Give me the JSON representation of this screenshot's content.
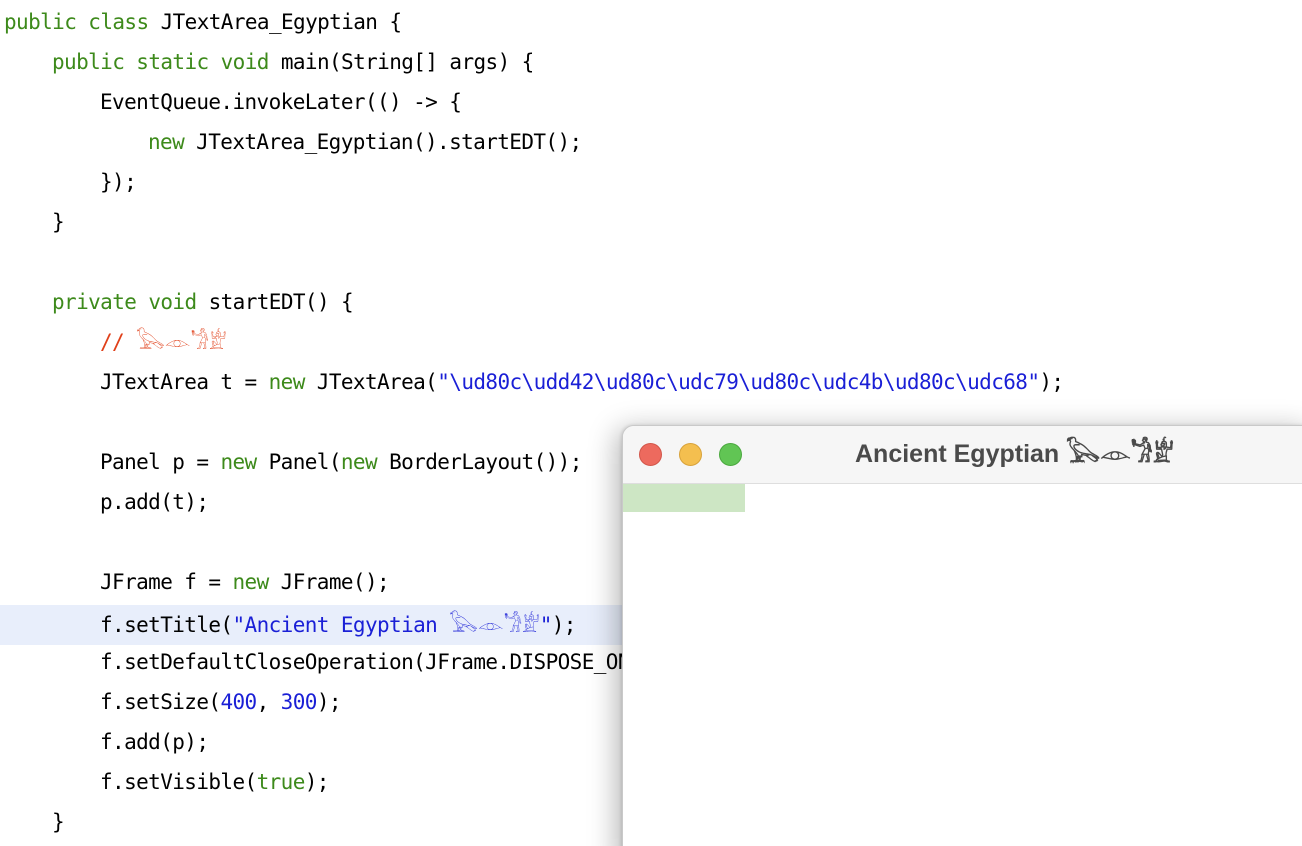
{
  "editor": {
    "lines": [
      {
        "segments": [
          {
            "t": "public class",
            "c": "kw"
          },
          {
            "t": " JTextArea_Egyptian {",
            "c": ""
          }
        ]
      },
      {
        "segments": [
          {
            "t": "public static void",
            "c": "kw"
          },
          {
            "t": " main(String[] args) {",
            "c": ""
          }
        ]
      },
      {
        "segments": [
          {
            "t": "EventQueue.invokeLater(() -> {",
            "c": ""
          }
        ]
      },
      {
        "segments": [
          {
            "t": "new",
            "c": "kw"
          },
          {
            "t": " JTextArea_Egyptian().startEDT();",
            "c": ""
          }
        ]
      },
      {
        "segments": [
          {
            "t": "});",
            "c": ""
          }
        ]
      },
      {
        "segments": [
          {
            "t": "}",
            "c": ""
          }
        ]
      },
      {
        "segments": []
      },
      {
        "segments": [
          {
            "t": "private void",
            "c": "kw"
          },
          {
            "t": " startEDT() {",
            "c": ""
          }
        ]
      },
      {
        "segments": [
          {
            "t": "// ",
            "c": "cmt"
          },
          {
            "t": "𓅂𓁹𓁋𓁨",
            "c": "cmt hiero"
          }
        ]
      },
      {
        "segments": [
          {
            "t": "JTextArea t = ",
            "c": ""
          },
          {
            "t": "new",
            "c": "kw"
          },
          {
            "t": " JTextArea(",
            "c": ""
          },
          {
            "t": "\"\\ud80c\\udd42\\ud80c\\udc79\\ud80c\\udc4b\\ud80c\\udc68\"",
            "c": "str"
          },
          {
            "t": ");",
            "c": ""
          }
        ]
      },
      {
        "segments": []
      },
      {
        "segments": [
          {
            "t": "Panel p = ",
            "c": ""
          },
          {
            "t": "new",
            "c": "kw"
          },
          {
            "t": " Panel(",
            "c": ""
          },
          {
            "t": "new",
            "c": "kw"
          },
          {
            "t": " BorderLayout());",
            "c": ""
          }
        ]
      },
      {
        "segments": [
          {
            "t": "p.add(t);",
            "c": ""
          }
        ]
      },
      {
        "segments": []
      },
      {
        "segments": [
          {
            "t": "JFrame f = ",
            "c": ""
          },
          {
            "t": "new",
            "c": "kw"
          },
          {
            "t": " JFrame();",
            "c": ""
          }
        ]
      },
      {
        "segments": [
          {
            "t": "f.setTitle(",
            "c": ""
          },
          {
            "t": "\"Ancient Egyptian ",
            "c": "str"
          },
          {
            "t": "𓅂𓁹𓁋𓁨",
            "c": "str hiero"
          },
          {
            "t": "\"",
            "c": "str"
          },
          {
            "t": ");",
            "c": ""
          }
        ]
      },
      {
        "segments": [
          {
            "t": "f.setDefaultCloseOperation(JFrame.DISPOSE_ON",
            "c": ""
          }
        ]
      },
      {
        "segments": [
          {
            "t": "f.setSize(",
            "c": ""
          },
          {
            "t": "400",
            "c": "num"
          },
          {
            "t": ", ",
            "c": ""
          },
          {
            "t": "300",
            "c": "num"
          },
          {
            "t": ");",
            "c": ""
          }
        ]
      },
      {
        "segments": [
          {
            "t": "f.add(p);",
            "c": ""
          }
        ]
      },
      {
        "segments": [
          {
            "t": "f.setVisible(",
            "c": ""
          },
          {
            "t": "true",
            "c": "kw"
          },
          {
            "t": ");",
            "c": ""
          }
        ]
      },
      {
        "segments": [
          {
            "t": "}",
            "c": ""
          }
        ]
      }
    ]
  },
  "window": {
    "title": "Ancient Egyptian 𓅂𓁹𓁋𓁨",
    "colors": {
      "close": "#ed6a5e",
      "minimize": "#f4bf4f",
      "maximize": "#61c554",
      "selection": "#cde6c4"
    }
  },
  "colors": {
    "keyword": "#3d8a1b",
    "string": "#1a1fd6",
    "comment": "#e0401a",
    "current_line": "#e8eefb"
  }
}
